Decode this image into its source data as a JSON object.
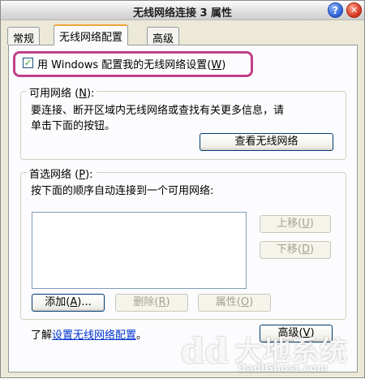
{
  "window": {
    "title": "无线网络连接 3 属性",
    "help_label": "?",
    "close_label": "✕"
  },
  "tabs": [
    {
      "label": "常规",
      "active": false
    },
    {
      "label": "无线网络配置",
      "active": true
    },
    {
      "label": "高级",
      "active": false
    }
  ],
  "use_windows_config": {
    "checked": true,
    "check_mark": "✓",
    "label_prefix": "用 Windows 配置我的无线网络设置(",
    "accel": "W",
    "label_suffix": ")"
  },
  "available_networks": {
    "title_prefix": "可用网络 (",
    "title_accel": "N",
    "title_suffix": "):",
    "description_line1": "要连接、断开区域内无线网络或查找有关更多信息，请",
    "description_line2": "单击下面的按钮。",
    "view_button": "查看无线网络"
  },
  "preferred_networks": {
    "title_prefix": "首选网络 (",
    "title_accel": "P",
    "title_suffix": "):",
    "description": "按下面的顺序自动连接到一个可用网络:",
    "items": [],
    "move_up": {
      "prefix": "上移(",
      "accel": "U",
      "suffix": ")",
      "enabled": false
    },
    "move_down": {
      "prefix": "下移(",
      "accel": "D",
      "suffix": ")",
      "enabled": false
    },
    "add": {
      "prefix": "添加(",
      "accel": "A",
      "suffix": ")...",
      "enabled": true
    },
    "remove": {
      "prefix": "删除(",
      "accel": "R",
      "suffix": ")",
      "enabled": false
    },
    "properties": {
      "prefix": "属性(",
      "accel": "O",
      "suffix": ")",
      "enabled": false
    }
  },
  "footer": {
    "learn_prefix": "了解",
    "learn_link": "设置无线网络配置",
    "learn_suffix": "。",
    "advanced": {
      "prefix": "高级(",
      "accel": "V",
      "suffix": ")",
      "enabled": true
    }
  },
  "watermark": {
    "logo": "dd",
    "name": "大地系统",
    "url": "DadiGhost.com"
  }
}
